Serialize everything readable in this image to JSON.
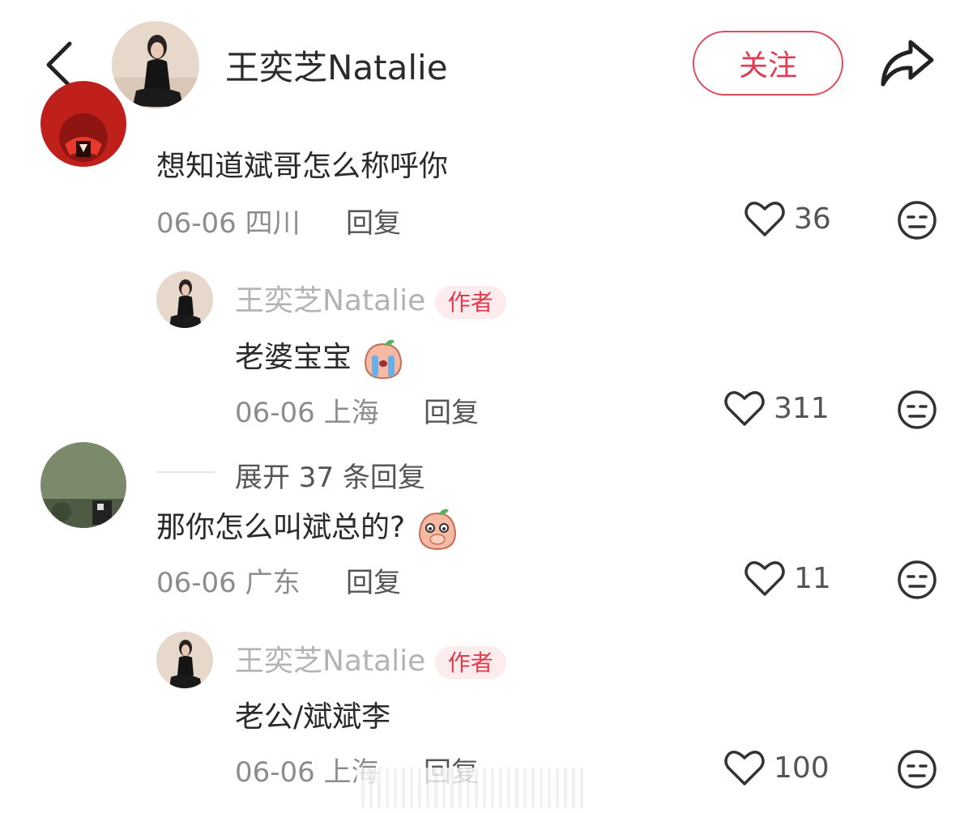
{
  "header": {
    "author_name": "王奕芝Natalie",
    "follow_label": "关注"
  },
  "comments": [
    {
      "text": "想知道斌哥怎么称呼你",
      "date": "06-06",
      "location": "四川",
      "reply_label": "回复",
      "likes": "36",
      "author_reply": {
        "name": "王奕芝Natalie",
        "badge": "作者",
        "text": "老婆宝宝",
        "date": "06-06",
        "location": "上海",
        "reply_label": "回复",
        "likes": "311"
      },
      "expand_label": "展开 37 条回复"
    },
    {
      "text": "那你怎么叫斌总的?",
      "date": "06-06",
      "location": "广东",
      "reply_label": "回复",
      "likes": "11",
      "author_reply": {
        "name": "王奕芝Natalie",
        "badge": "作者",
        "text": "老公/斌斌李",
        "date": "06-06",
        "location": "上海",
        "reply_label": "回复",
        "likes": "100"
      }
    }
  ],
  "icons": {
    "back": "chevron-left-icon",
    "share": "share-arrow-icon",
    "like": "heart-outline-icon",
    "dislike": "meh-face-icon"
  },
  "colors": {
    "accent": "#e23a4f",
    "badge_bg": "#fdecee",
    "muted": "#8c8c8c"
  }
}
